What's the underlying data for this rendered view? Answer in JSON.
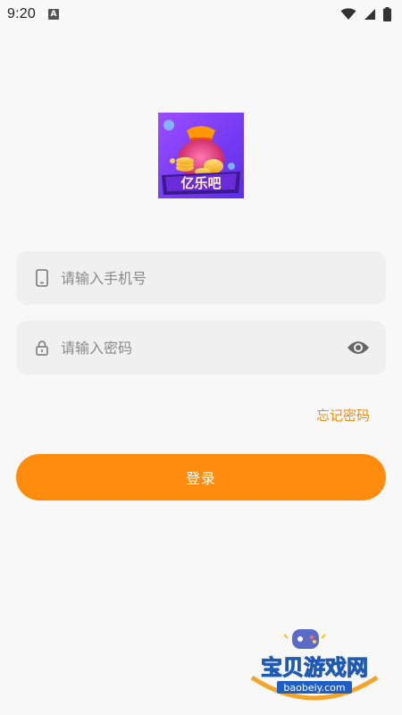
{
  "status_bar": {
    "time": "9:20",
    "notification_glyph": "A",
    "icons": [
      "wifi-icon",
      "signal-icon",
      "battery-icon"
    ]
  },
  "logo": {
    "icon": "money-bag-logo",
    "text": "亿乐吧"
  },
  "login_form": {
    "phone": {
      "icon": "phone-icon",
      "value": "",
      "placeholder": "请输入手机号"
    },
    "password": {
      "icon": "lock-icon",
      "value": "",
      "placeholder": "请输入密码",
      "toggle_icon": "eye-icon"
    },
    "forgot_password": "忘记密码",
    "login_button": "登录"
  },
  "watermark": {
    "text": "宝贝游戏网",
    "url": "baobeiy.com"
  },
  "colors": {
    "accent": "#ff8c0d",
    "link": "#f08c12",
    "field_bg": "#f0f0f0",
    "page_bg": "#f8f8f8"
  }
}
